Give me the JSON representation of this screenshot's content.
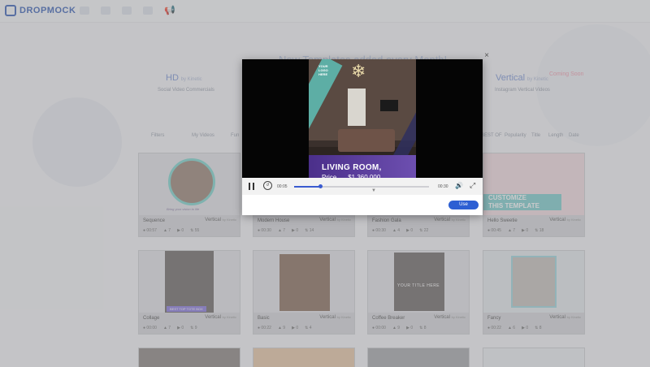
{
  "brand": {
    "logo_text": "DROPMOCK"
  },
  "banner": {
    "text": "New Templates added every Month!"
  },
  "features": [
    {
      "title": "HD",
      "by": "by Kinetic",
      "subtitle": "Social Video Commercials"
    },
    {
      "title": "Vertical",
      "by": "by Kinetic",
      "subtitle": "Instagram Vertical Videos",
      "badge": "Coming Soon"
    }
  ],
  "filters": {
    "left": [
      "Filters",
      "My Videos",
      "Fun"
    ],
    "right": [
      "BEST OF",
      "Popularity",
      "Title",
      "Length",
      "Date"
    ]
  },
  "cards": [
    {
      "title": "Sequence",
      "type": "Vertical",
      "by": "by Kinetic",
      "duration": "00:57",
      "likes": "7",
      "plays": "0",
      "templates": "55"
    },
    {
      "title": "Modern House",
      "type": "Vertical",
      "by": "by Kinetic",
      "duration": "00:30",
      "likes": "7",
      "plays": "0",
      "templates": "14"
    },
    {
      "title": "Fashion Gala",
      "type": "Vertical",
      "by": "by Kinetic",
      "duration": "00:30",
      "likes": "4",
      "plays": "0",
      "templates": "22"
    },
    {
      "title": "Hello Sweetie",
      "type": "Vertical",
      "by": "by Kinetic",
      "duration": "00:45",
      "likes": "7",
      "plays": "0",
      "templates": "18"
    },
    {
      "title": "Collage",
      "type": "Vertical",
      "by": "by Kinetic",
      "duration": "00:00",
      "likes": "7",
      "plays": "0",
      "templates": "9"
    },
    {
      "title": "Basic",
      "type": "Vertical",
      "by": "by Kinetic",
      "duration": "00:22",
      "likes": "9",
      "plays": "0",
      "templates": "4"
    },
    {
      "title": "Coffee Breaker",
      "type": "Vertical",
      "by": "by Kinetic",
      "duration": "00:00",
      "likes": "9",
      "plays": "0",
      "templates": "8"
    },
    {
      "title": "Fancy",
      "type": "Vertical",
      "by": "by Kinetic",
      "duration": "00:22",
      "likes": "6",
      "plays": "0",
      "templates": "8"
    }
  ],
  "thumb_text": {
    "sequence_caption": "Bring your vision to life",
    "customize_line1": "CUSTOMIZE",
    "customize_line2": "THIS TEMPLATE",
    "collage_tag": "BEST TOP TOTE BOX",
    "coffee_title": "YOUR TITLE HERE"
  },
  "modal": {
    "logo_text": "YOUR LOGO HERE",
    "heading": "LIVING ROOM,",
    "price_label": "Price",
    "price_value": "$1,360,000",
    "current_time": "00:05",
    "end_time": "00:30",
    "progress_fraction": 0.19,
    "use_label": "Use",
    "close_symbol": "×"
  },
  "colors": {
    "accent": "#2d5fd3",
    "brand": "#3b63b8"
  }
}
